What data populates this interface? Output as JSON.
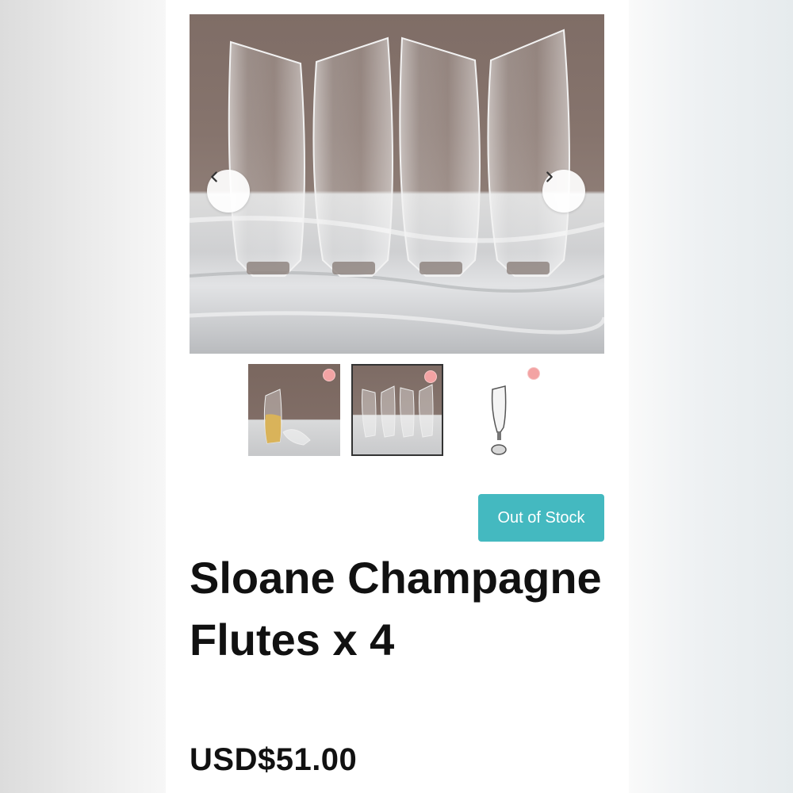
{
  "product": {
    "title": "Sloane Champagne Flutes x 4",
    "price": "USD$51.00",
    "stock_label": "Out of Stock"
  },
  "gallery": {
    "main_image_alt": "",
    "thumbnail_count": 3,
    "selected_thumbnail": 2,
    "icons": {
      "prev": "chevron-left-icon",
      "next": "chevron-right-icon"
    }
  },
  "colors": {
    "stock_button": "#44b9c0",
    "badge_dot": "#f3a3a3",
    "text": "#111111"
  }
}
